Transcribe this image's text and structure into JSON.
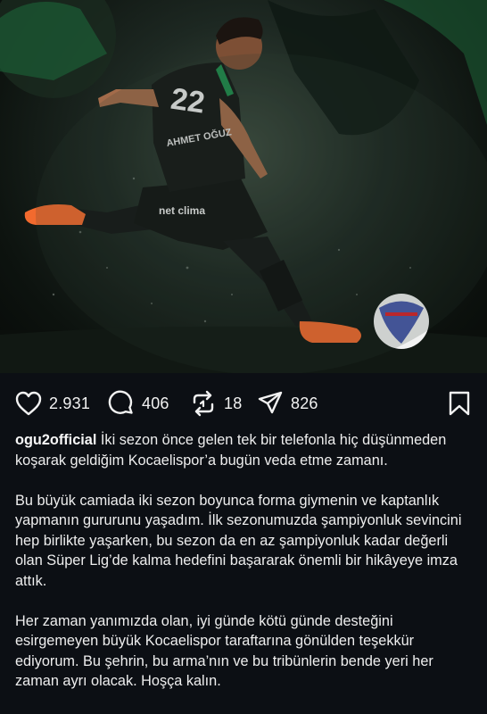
{
  "post": {
    "image_alt": "",
    "jersey_number": "22",
    "jersey_name": "AHMET OĞUZ",
    "jersey_sponsor": "net clima"
  },
  "actions": {
    "likes": "2.931",
    "comments": "406",
    "reposts": "18",
    "shares": "826"
  },
  "caption": {
    "username": "ogu2official",
    "paragraph1": "İki sezon önce gelen tek bir telefonla hiç düşünmeden koşarak geldiğim Kocaelispor’a bugün veda etme zamanı.",
    "paragraph2": "Bu büyük camiada iki sezon boyunca forma giymenin ve kaptanlık yapmanın gururunu yaşadım. İlk sezonumuzda şampiyonluk sevincini hep birlikte yaşarken, bu sezon da en az şampiyonluk kadar değerli olan Süper Lig’de kalma hedefini başararak önemli bir hikâyeye imza attık.",
    "paragraph3": "Her zaman yanımızda olan, iyi günde kötü günde desteğini esirgemeyen büyük Kocaelispor taraftarına gönülden teşekkür ediyorum. Bu şehrin, bu arma’nın ve bu tribünlerin bende yeri her zaman ayrı olacak. Hoşça kalın."
  },
  "colors": {
    "background": "#0c0f14",
    "text": "#f2f2f2",
    "boot": "#f26a2e",
    "kit": "#151817",
    "kit_accent": "#1f8a4c"
  },
  "icons": [
    "heart-icon",
    "comment-icon",
    "repost-icon",
    "share-icon",
    "bookmark-icon"
  ]
}
